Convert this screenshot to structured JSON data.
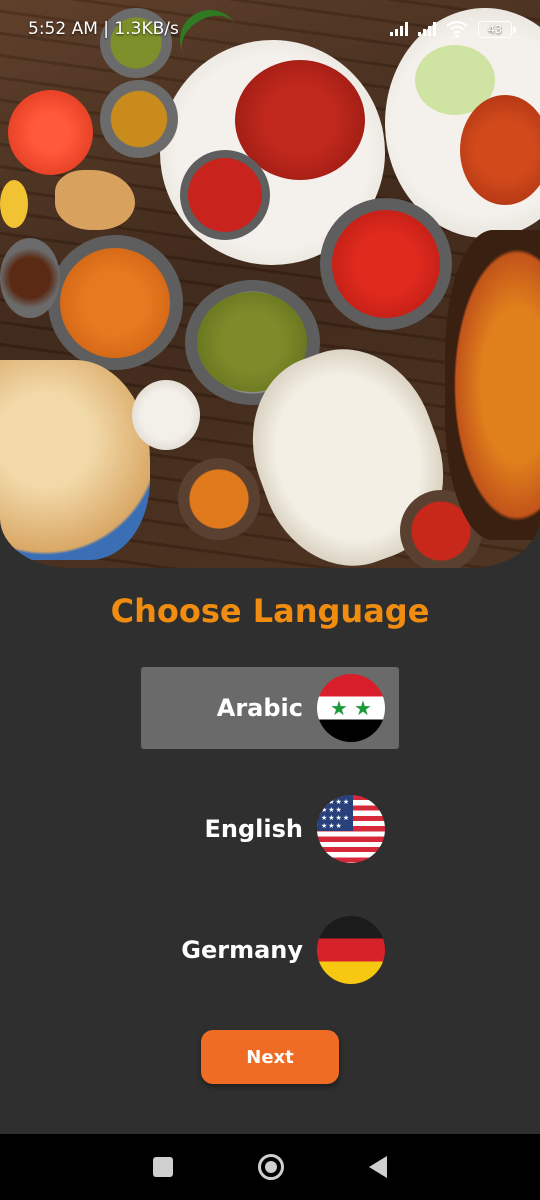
{
  "status_bar": {
    "time_speed": "5:52 AM | 1.3KB/s",
    "battery": "43"
  },
  "screen": {
    "title": "Choose Language",
    "languages": [
      {
        "label": "Arabic",
        "flag": "syria-flag-icon",
        "selected": true
      },
      {
        "label": "English",
        "flag": "usa-flag-icon",
        "selected": false
      },
      {
        "label": "Germany",
        "flag": "germany-flag-icon",
        "selected": false
      }
    ],
    "next_label": "Next"
  },
  "colors": {
    "title": "#f08d10",
    "button": "#ef6c24",
    "background": "#2f2f2f",
    "selected_row": "#6a6a6a"
  }
}
